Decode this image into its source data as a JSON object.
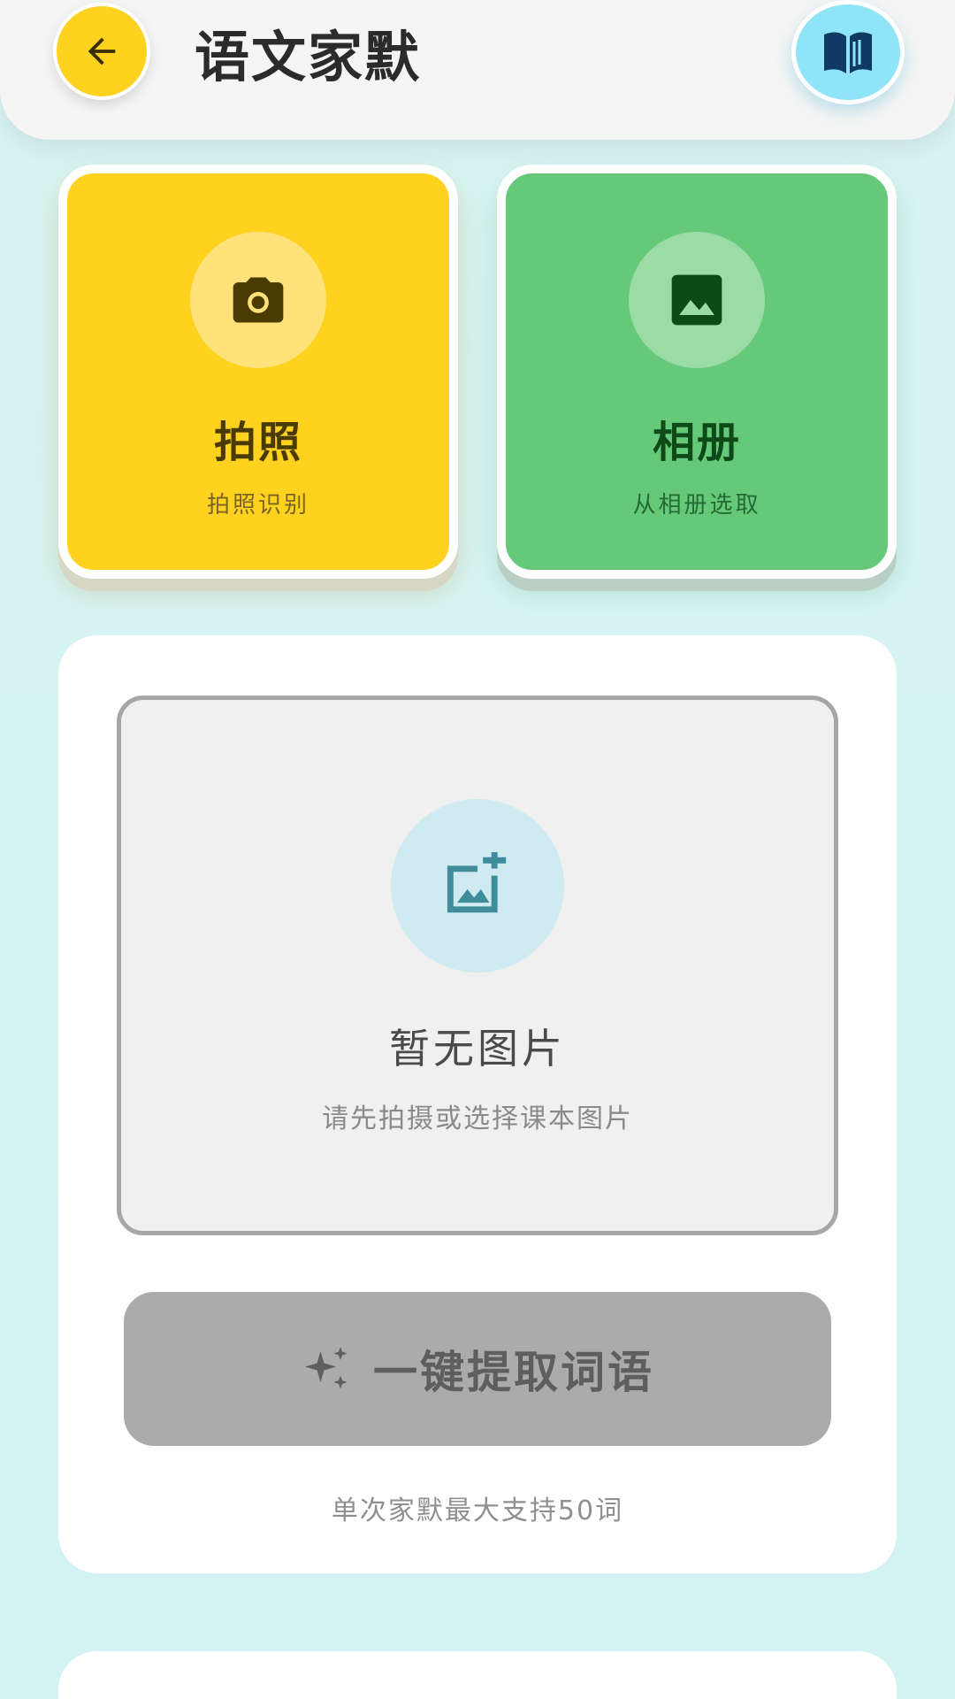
{
  "header": {
    "title": "语文家默",
    "back_icon": "arrow-left-icon",
    "book_icon": "open-book-icon"
  },
  "actions": [
    {
      "key": "camera",
      "icon": "camera-icon",
      "label": "拍照",
      "sub": "拍照识别",
      "color": "#ffd21f"
    },
    {
      "key": "album",
      "icon": "image-icon",
      "label": "相册",
      "sub": "从相册选取",
      "color": "#66c97a"
    }
  ],
  "upload": {
    "icon": "add-image-icon",
    "empty_title": "暂无图片",
    "empty_sub": "请先拍摄或选择课本图片"
  },
  "extract": {
    "icon": "sparkle-icon",
    "label": "一键提取词语",
    "note": "单次家默最大支持50词"
  },
  "colors": {
    "background": "#d6f4f4",
    "accent_yellow": "#ffd21f",
    "accent_green": "#66c97a",
    "accent_cyan": "#8fe4f7",
    "disabled_button": "#ababab"
  }
}
